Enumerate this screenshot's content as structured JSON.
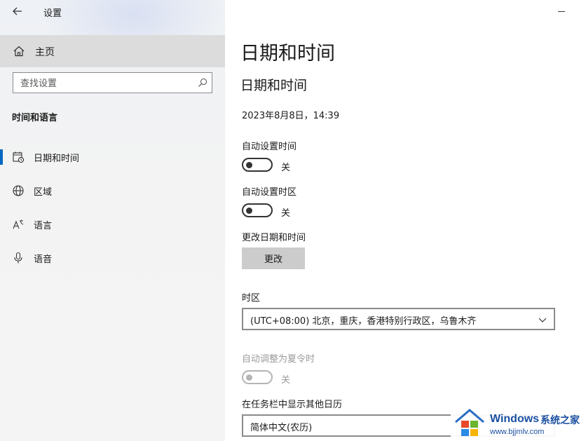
{
  "window": {
    "title": "设置"
  },
  "sidebar": {
    "home_label": "主页",
    "search_placeholder": "查找设置",
    "section_title": "时间和语言",
    "items": [
      {
        "label": "日期和时间",
        "icon": "calendar-clock-icon",
        "active": true
      },
      {
        "label": "区域",
        "icon": "globe-icon",
        "active": false
      },
      {
        "label": "语言",
        "icon": "language-icon",
        "active": false
      },
      {
        "label": "语音",
        "icon": "microphone-icon",
        "active": false
      }
    ]
  },
  "main": {
    "page_title": "日期和时间",
    "section_title": "日期和时间",
    "current_datetime": "2023年8月8日，14:39",
    "auto_time": {
      "label": "自动设置时间",
      "state": "关"
    },
    "auto_timezone": {
      "label": "自动设置时区",
      "state": "关"
    },
    "change_datetime": {
      "label": "更改日期和时间",
      "button": "更改"
    },
    "timezone": {
      "label": "时区",
      "value": "(UTC+08:00) 北京，重庆，香港特别行政区，乌鲁木齐"
    },
    "dst": {
      "label": "自动调整为夏令时",
      "state": "关"
    },
    "calendar": {
      "label": "在任务栏中显示其他日历",
      "value": "简体中文(农历)"
    }
  },
  "watermark": {
    "brand": "Windows",
    "brand_cn": "系统之家",
    "url": "www.bjjmlv.com"
  },
  "colors": {
    "accent": "#0067c0",
    "sidebar_bg": "#f3f3f3",
    "home_bg": "#dcdcdc"
  }
}
